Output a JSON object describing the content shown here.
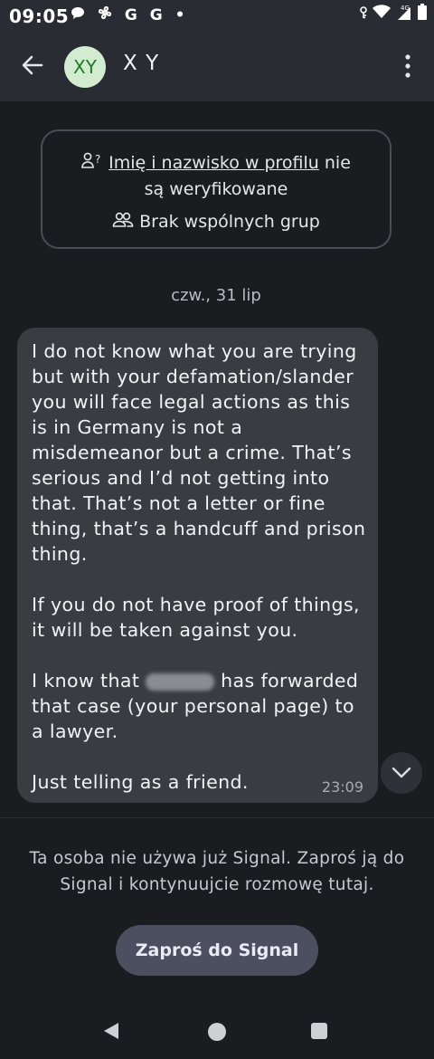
{
  "status_bar": {
    "time": "09:05",
    "left_icons": [
      "chat-bubble-icon",
      "fan-icon",
      "G",
      "G",
      "•"
    ],
    "network": "4G"
  },
  "header": {
    "back_icon": "arrow-left-icon",
    "avatar_initials": "XY",
    "contact_name": "X Y",
    "menu_icon": "more-vertical-icon"
  },
  "info_card": {
    "profile_name_link": "Imię i nazwisko w profilu",
    "profile_name_suffix": " nie",
    "profile_name_line2": "są weryfikowane",
    "groups_text": "Brak wspólnych grup"
  },
  "conversation": {
    "date_separator": "czw., 31 lip",
    "message": {
      "part1": "I do not know what you are trying but with your defamation/slander you will face legal actions as this is in Germany is not a misdemeanor but a crime. That’s serious and I’d not getting into that. That’s not a letter or fine thing, that’s a handcuff and prison thing.\n\nIf you do not have proof of things, it will be taken against you.\n\nI know that ",
      "part2": " has forwarded that case (your personal page) to a lawyer.\n\nJust telling as a friend.",
      "time": "23:09"
    }
  },
  "footer": {
    "notice": "Ta osoba nie używa już Signal. Zaproś ją do Signal i kontynuujcie rozmowę tutaj.",
    "invite_button": "Zaproś do Signal"
  },
  "colors": {
    "background": "#1b1c20",
    "app_bar": "#2a2c33",
    "bubble": "#3b3c42",
    "avatar_bg": "#d3ecd1",
    "avatar_text": "#1e7a27",
    "button": "#4b4f60"
  }
}
